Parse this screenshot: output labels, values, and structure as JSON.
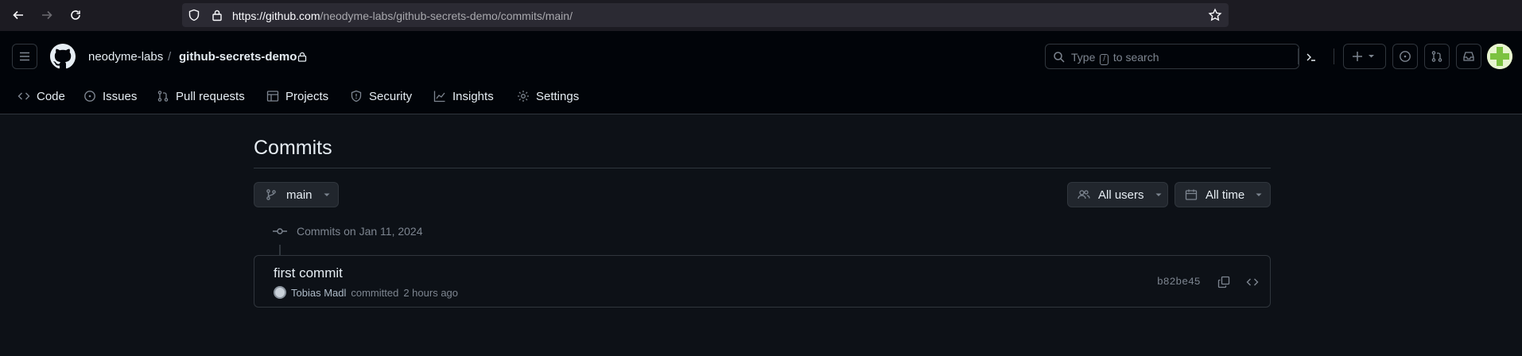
{
  "browser": {
    "url_host": "https://github.com",
    "url_path": "/neodyme-labs/github-secrets-demo/commits/main/"
  },
  "header": {
    "owner": "neodyme-labs",
    "separator": "/",
    "repo": "github-secrets-demo",
    "search_prefix": "Type",
    "search_key": "/",
    "search_suffix": "to search"
  },
  "repo_nav": {
    "tabs": [
      {
        "label": "Code",
        "icon": "code-icon"
      },
      {
        "label": "Issues",
        "icon": "issue-icon"
      },
      {
        "label": "Pull requests",
        "icon": "pull-request-icon"
      },
      {
        "label": "Projects",
        "icon": "table-icon"
      },
      {
        "label": "Security",
        "icon": "shield-icon"
      },
      {
        "label": "Insights",
        "icon": "graph-icon"
      },
      {
        "label": "Settings",
        "icon": "gear-icon"
      }
    ]
  },
  "main": {
    "title": "Commits",
    "branch": "main",
    "users_filter": "All users",
    "time_filter": "All time",
    "date_heading": "Commits on Jan 11, 2024",
    "commits": [
      {
        "message": "first commit",
        "author": "Tobias Madl",
        "action": "committed",
        "time": "2 hours ago",
        "sha": "b82be45"
      }
    ]
  },
  "colors": {
    "background": "#0d1117",
    "header_bg": "#010409",
    "border": "#30363d",
    "text": "#e6edf3",
    "muted": "#7d8590",
    "button_bg": "#21262d"
  }
}
